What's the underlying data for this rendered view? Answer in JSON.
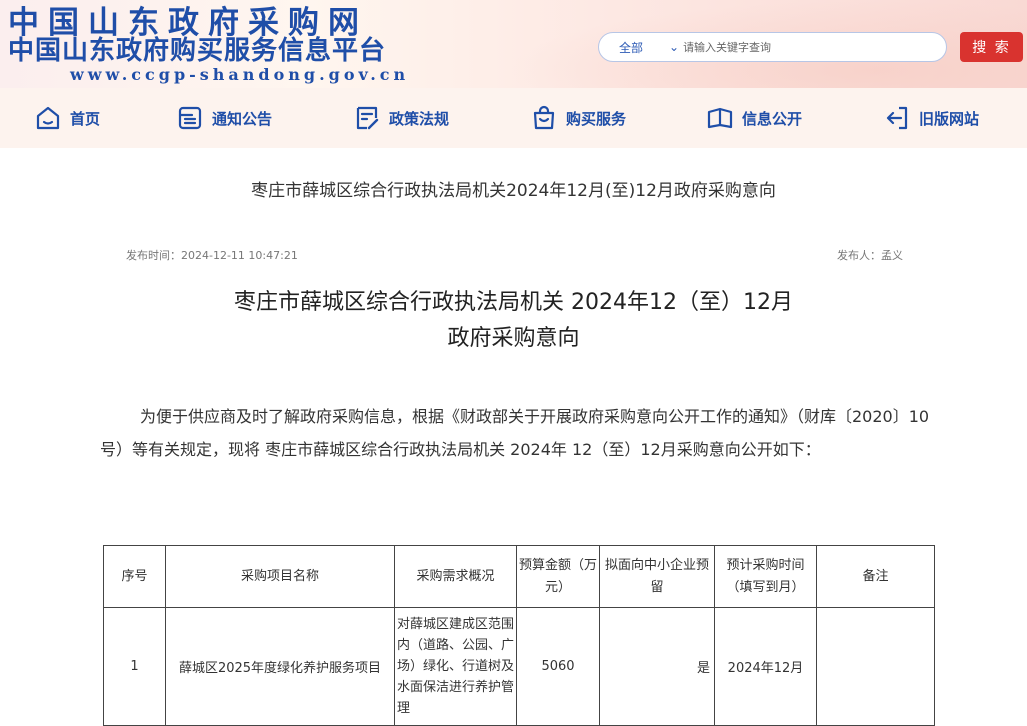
{
  "header": {
    "logo_line1": "中国山东政府采购网",
    "logo_line2": "中国山东政府购买服务信息平台",
    "logo_line3": "www.ccgp-shandong.gov.cn",
    "search_scope": "全部",
    "search_placeholder": "请输入关键字查询",
    "search_button": "搜 索"
  },
  "nav": {
    "items": [
      {
        "label": "首页",
        "icon": "home-icon"
      },
      {
        "label": "通知公告",
        "icon": "notice-icon"
      },
      {
        "label": "政策法规",
        "icon": "policy-icon"
      },
      {
        "label": "购买服务",
        "icon": "shopping-bag-icon"
      },
      {
        "label": "信息公开",
        "icon": "book-icon"
      },
      {
        "label": "旧版网站",
        "icon": "exit-icon"
      }
    ]
  },
  "article": {
    "subtitle": "枣庄市薛城区综合行政执法局机关2024年12月(至)12月政府采购意向",
    "publish_time": "发布时间：2024-12-11 10:47:21",
    "publisher": "发布人：孟义",
    "title_line1": "枣庄市薛城区综合行政执法局机关 2024年12（至）12月",
    "title_line2": "政府采购意向",
    "body": "为便于供应商及时了解政府采购信息，根据《财政部关于开展政府采购意向公开工作的通知》（财库〔2020〕10号）等有关规定，现将 枣庄市薛城区综合行政执法局机关 2024年 12（至）12月采购意向公开如下："
  },
  "table": {
    "headers": [
      "序号",
      "采购项目名称",
      "采购需求概况",
      "预算金额（万元）",
      "拟面向中小企业预留",
      "预计采购时间（填写到月）",
      "备注"
    ],
    "rows": [
      {
        "no": "1",
        "name": "薛城区2025年度绿化养护服务项目",
        "desc": "对薛城区建成区范围内（道路、公园、广场）绿化、行道树及水面保洁进行养护管理",
        "budget": "5060",
        "sme": "是",
        "time": "2024年12月",
        "note": ""
      }
    ]
  },
  "colors": {
    "brand_blue": "#1f4ea8",
    "search_button_red": "#d9332f"
  }
}
